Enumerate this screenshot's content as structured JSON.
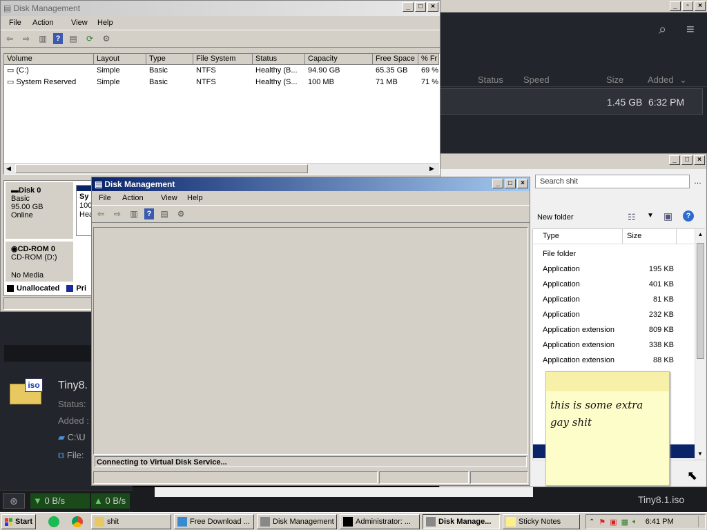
{
  "torrent_app": {
    "columns": {
      "status": "Status",
      "speed": "Speed",
      "size": "Size",
      "added": "Added"
    },
    "row": {
      "size": "1.45 GB",
      "added": "6:32 PM"
    },
    "detail": {
      "name": "Tiny8.",
      "status_label": "Status:",
      "added_label": "Added :",
      "path": "C:\\U",
      "file_label": "File:",
      "bottom_name": "Tiny8.1.iso"
    },
    "speeds": {
      "down": "0 B/s",
      "up": "0 B/s"
    }
  },
  "explorer": {
    "search_placeholder": "Search shit",
    "new_folder": "New folder",
    "columns": {
      "type": "Type",
      "size": "Size"
    },
    "rows": [
      {
        "type": "File folder",
        "size": ""
      },
      {
        "type": "Application",
        "size": "195 KB"
      },
      {
        "type": "Application",
        "size": "401 KB"
      },
      {
        "type": "Application",
        "size": "81 KB"
      },
      {
        "type": "Application",
        "size": "232 KB"
      },
      {
        "type": "Application extension",
        "size": "809 KB"
      },
      {
        "type": "Application extension",
        "size": "338 KB"
      },
      {
        "type": "Application extension",
        "size": "88 KB"
      }
    ]
  },
  "dm_back": {
    "title": "Disk Management",
    "menu": [
      "File",
      "Action",
      "View",
      "Help"
    ],
    "columns": [
      "Volume",
      "Layout",
      "Type",
      "File System",
      "Status",
      "Capacity",
      "Free Space",
      "% Fr"
    ],
    "rows": [
      [
        "(C:)",
        "Simple",
        "Basic",
        "NTFS",
        "Healthy (B...",
        "94.90 GB",
        "65.35 GB",
        "69 %"
      ],
      [
        "System Reserved",
        "Simple",
        "Basic",
        "NTFS",
        "Healthy (S...",
        "100 MB",
        "71 MB",
        "71 %"
      ]
    ],
    "disk0": {
      "name": "Disk 0",
      "type": "Basic",
      "size": "95.00 GB",
      "state": "Online",
      "part_label": "Sy",
      "part_size": "100",
      "part_status": "Hea"
    },
    "cdrom": {
      "name": "CD-ROM 0",
      "drive": "CD-ROM (D:)",
      "media": "No Media"
    },
    "legend": {
      "unallocated": "Unallocated",
      "primary": "Pri"
    }
  },
  "dm_front": {
    "title": "Disk Management",
    "menu": [
      "File",
      "Action",
      "View",
      "Help"
    ],
    "status": "Connecting to Virtual Disk Service..."
  },
  "sticky": {
    "text": "this is some extra gay shit"
  },
  "taskbar": {
    "start": "Start",
    "buttons": [
      "shit",
      "Free Download ...",
      "Disk Management",
      "Administrator: ...",
      "Disk Manage...",
      "Sticky Notes"
    ],
    "clock": "6:41 PM"
  },
  "colors": {
    "accent_blue": "#0a246a",
    "sticky_yellow": "#fdfdca",
    "dark_app": "#22252b"
  }
}
